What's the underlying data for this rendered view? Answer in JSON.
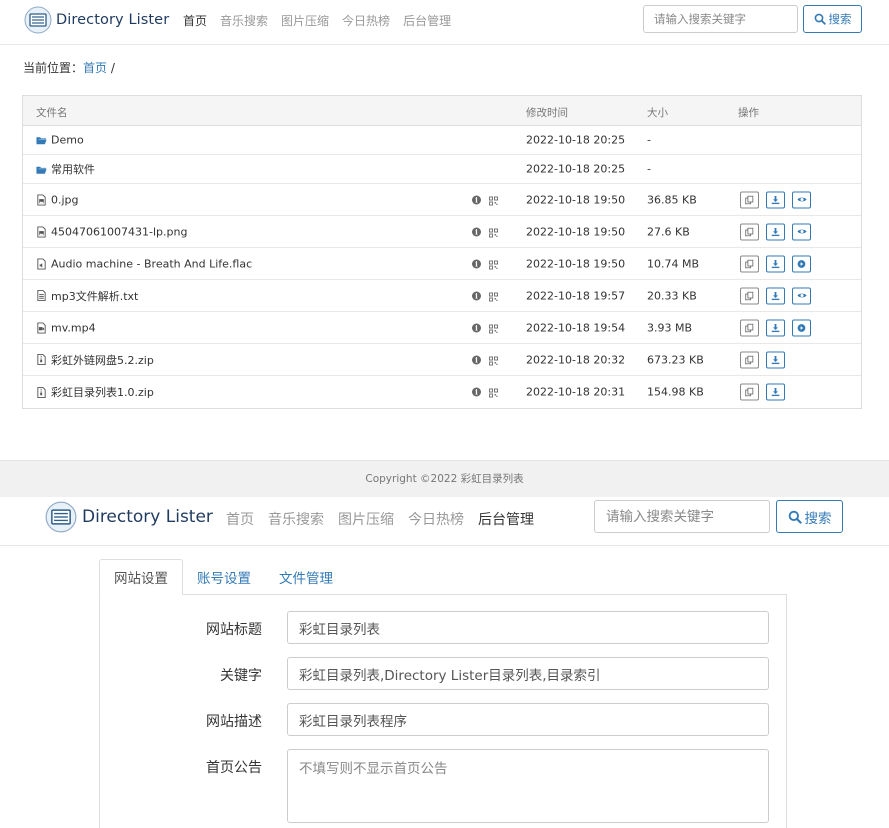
{
  "screen1": {
    "brand": "Directory Lister",
    "nav": [
      {
        "label": "首页",
        "active": true
      },
      {
        "label": "音乐搜索",
        "active": false
      },
      {
        "label": "图片压缩",
        "active": false
      },
      {
        "label": "今日热榜",
        "active": false
      },
      {
        "label": "后台管理",
        "active": false
      }
    ],
    "search_placeholder": "请输入搜索关键字",
    "search_button": "搜索",
    "breadcrumb": {
      "prefix": "当前位置：",
      "home": "首页",
      "sep": "/"
    },
    "table": {
      "headers": {
        "name": "文件名",
        "time": "修改时间",
        "size": "大小",
        "ops": "操作"
      },
      "rows": [
        {
          "type": "dir",
          "icon": "folder-open-icon",
          "name": "Demo",
          "time": "2022-10-18 20:25",
          "size": "-",
          "ops": []
        },
        {
          "type": "dir",
          "icon": "folder-open-icon",
          "name": "常用软件",
          "time": "2022-10-18 20:25",
          "size": "-",
          "ops": []
        },
        {
          "type": "file",
          "icon": "image-file-icon",
          "name": "0.jpg",
          "time": "2022-10-18 19:50",
          "size": "36.85 KB",
          "ops": [
            "copy",
            "download",
            "preview"
          ]
        },
        {
          "type": "file",
          "icon": "image-file-icon",
          "name": "45047061007431-lp.png",
          "time": "2022-10-18 19:50",
          "size": "27.6 KB",
          "ops": [
            "copy",
            "download",
            "preview"
          ]
        },
        {
          "type": "file",
          "icon": "audio-file-icon",
          "name": "Audio machine - Breath And Life.flac",
          "time": "2022-10-18 19:50",
          "size": "10.74 MB",
          "ops": [
            "copy",
            "download",
            "play"
          ]
        },
        {
          "type": "file",
          "icon": "text-file-icon",
          "name": "mp3文件解析.txt",
          "time": "2022-10-18 19:57",
          "size": "20.33 KB",
          "ops": [
            "copy",
            "download",
            "preview"
          ]
        },
        {
          "type": "file",
          "icon": "video-file-icon",
          "name": "mv.mp4",
          "time": "2022-10-18 19:54",
          "size": "3.93 MB",
          "ops": [
            "copy",
            "download",
            "play"
          ]
        },
        {
          "type": "file",
          "icon": "zip-file-icon",
          "name": "彩虹外链网盘5.2.zip",
          "time": "2022-10-18 20:32",
          "size": "673.23 KB",
          "ops": [
            "copy",
            "download"
          ]
        },
        {
          "type": "file",
          "icon": "zip-file-icon",
          "name": "彩虹目录列表1.0.zip",
          "time": "2022-10-18 20:31",
          "size": "154.98 KB",
          "ops": [
            "copy",
            "download"
          ]
        }
      ]
    },
    "footer": "Copyright ©2022 彩虹目录列表"
  },
  "screen2": {
    "brand": "Directory Lister",
    "nav": [
      {
        "label": "首页",
        "active": false
      },
      {
        "label": "音乐搜索",
        "active": false
      },
      {
        "label": "图片压缩",
        "active": false
      },
      {
        "label": "今日热榜",
        "active": false
      },
      {
        "label": "后台管理",
        "active": true
      }
    ],
    "search_placeholder": "请输入搜索关键字",
    "search_button": "搜索",
    "tabs": [
      {
        "label": "网站设置",
        "active": true
      },
      {
        "label": "账号设置",
        "active": false
      },
      {
        "label": "文件管理",
        "active": false
      }
    ],
    "form": {
      "site_title": {
        "label": "网站标题",
        "value": "彩虹目录列表"
      },
      "keywords": {
        "label": "关键字",
        "value": "彩虹目录列表,Directory Lister目录列表,目录索引"
      },
      "description": {
        "label": "网站描述",
        "value": "彩虹目录列表程序"
      },
      "notice": {
        "label": "首页公告",
        "placeholder": "不填写则不显示首页公告",
        "value": ""
      }
    }
  },
  "colors": {
    "link": "#337ab7",
    "brand_text": "#1f3a5f",
    "muted": "#999999"
  }
}
